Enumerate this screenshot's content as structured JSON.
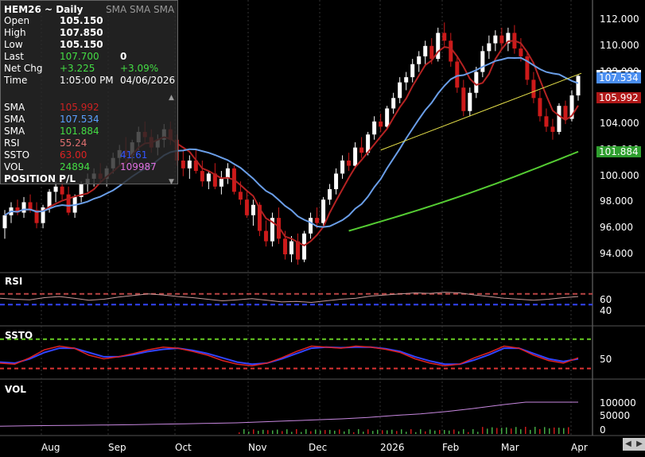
{
  "symbol_title": "HEM26 ~ Daily",
  "sma_header": "SMA SMA SMA",
  "info_rows": [
    {
      "label": "Open",
      "value": "105.150",
      "value2": ""
    },
    {
      "label": "High",
      "value": "107.850",
      "value2": ""
    },
    {
      "label": "Low",
      "value": "105.150",
      "value2": ""
    },
    {
      "label": "Last",
      "value": "107.700",
      "value2": "0"
    },
    {
      "label": "Net Chg",
      "value": "+3.225",
      "value2": "+3.09%"
    },
    {
      "label": "Time",
      "value": "1:05:00 PM",
      "value2": "04/06/2026"
    }
  ],
  "indicator_rows": [
    {
      "label": "SMA",
      "value": "105.992",
      "value2": "",
      "color": "#cc2222"
    },
    {
      "label": "SMA",
      "value": "107.534",
      "value2": "",
      "color": "#5aa0ff"
    },
    {
      "label": "SMA",
      "value": "101.884",
      "value2": "",
      "color": "#44dd44"
    },
    {
      "label": "RSI",
      "value": "55.24",
      "value2": "",
      "color": "#e07070"
    },
    {
      "label": "SSTO",
      "value": "63.00",
      "value2": "41.61",
      "color": "#dd2222",
      "color2": "#3355ff"
    },
    {
      "label": "VOL",
      "value": "24894",
      "value2": "109987",
      "color": "#44dd44",
      "color2": "#e070e0"
    }
  ],
  "position_pl": "POSITION P/L",
  "price_axis": [
    "112.000",
    "110.000",
    "108.000",
    "106.000",
    "104.000",
    "102.000",
    "100.000",
    "98.000",
    "96.000",
    "94.000"
  ],
  "price_tags": [
    {
      "text": "107.700",
      "bg": "#ffffff",
      "fg": "#000000"
    },
    {
      "text": "107.534",
      "bg": "#4a8ef0",
      "fg": "#ffffff"
    },
    {
      "text": "105.992",
      "bg": "#b01818",
      "fg": "#ffffff"
    },
    {
      "text": "101.884",
      "bg": "#2e9e2e",
      "fg": "#ffffff"
    }
  ],
  "panels": {
    "rsi": {
      "label": "RSI",
      "axis": [
        "60",
        "40"
      ]
    },
    "ssto": {
      "label": "SSTO",
      "axis": [
        "50"
      ]
    },
    "vol": {
      "label": "VOL",
      "axis": [
        "100000",
        "50000",
        "0"
      ]
    }
  },
  "months": [
    "Aug",
    "Sep",
    "Oct",
    "Nov",
    "Dec",
    "2026",
    "Feb",
    "Mar",
    "Apr"
  ],
  "colors": {
    "up": "#ffffff",
    "down": "#cc1a1a",
    "sma_short": "#b52222",
    "sma_mid": "#6a9ee8",
    "sma_long": "#55cc33",
    "trendline": "#e8e24a",
    "rsi_line": "#c79a9a",
    "rsi_hi": "#b84444",
    "rsi_lo": "#3344ff",
    "ssto_k": "#dd2222",
    "ssto_d": "#3344ff",
    "ssto_hi": "#66cc22",
    "ssto_lo": "#dd3333",
    "vol_line": "#c888e0",
    "vol_bar": "#44aa44"
  },
  "chart_data": {
    "type": "candlestick",
    "symbol": "HEM26",
    "period": "Daily",
    "ylim": [
      93,
      113
    ],
    "indicators": [
      {
        "name": "SMA",
        "last": 105.992
      },
      {
        "name": "SMA",
        "last": 107.534
      },
      {
        "name": "SMA",
        "last": 101.884
      },
      {
        "name": "RSI",
        "last": 55.24
      },
      {
        "name": "SSTO",
        "last": [
          63.0,
          41.61
        ]
      },
      {
        "name": "VOL",
        "last": [
          24894,
          109987
        ]
      }
    ],
    "candles": [
      [
        96.0,
        97.4,
        95.2,
        97.0
      ],
      [
        97.0,
        98.0,
        96.4,
        97.6
      ],
      [
        97.6,
        98.2,
        97.0,
        97.2
      ],
      [
        97.2,
        98.4,
        96.8,
        98.0
      ],
      [
        98.0,
        98.6,
        97.2,
        97.4
      ],
      [
        97.4,
        98.0,
        96.0,
        96.4
      ],
      [
        96.4,
        97.8,
        96.0,
        97.6
      ],
      [
        97.6,
        99.0,
        97.2,
        98.8
      ],
      [
        98.8,
        99.6,
        98.0,
        99.2
      ],
      [
        99.2,
        99.8,
        98.2,
        98.6
      ],
      [
        98.6,
        99.2,
        97.0,
        97.2
      ],
      [
        97.2,
        98.6,
        96.8,
        98.4
      ],
      [
        98.4,
        99.6,
        98.0,
        99.4
      ],
      [
        99.4,
        100.2,
        98.8,
        99.8
      ],
      [
        99.8,
        100.6,
        99.2,
        100.2
      ],
      [
        100.2,
        101.0,
        99.4,
        99.8
      ],
      [
        99.8,
        100.8,
        99.2,
        100.6
      ],
      [
        100.6,
        101.8,
        100.2,
        101.4
      ],
      [
        101.4,
        102.4,
        100.8,
        102.0
      ],
      [
        102.0,
        103.0,
        101.2,
        101.6
      ],
      [
        101.6,
        102.8,
        101.0,
        102.6
      ],
      [
        102.6,
        103.8,
        102.0,
        103.4
      ],
      [
        103.4,
        104.2,
        102.6,
        103.0
      ],
      [
        103.0,
        103.6,
        101.8,
        102.2
      ],
      [
        102.2,
        103.2,
        101.6,
        102.8
      ],
      [
        102.8,
        104.0,
        102.2,
        103.6
      ],
      [
        103.6,
        104.2,
        102.4,
        102.8
      ],
      [
        102.8,
        103.2,
        100.8,
        101.2
      ],
      [
        101.2,
        102.0,
        100.0,
        100.6
      ],
      [
        100.6,
        101.6,
        99.8,
        101.2
      ],
      [
        101.2,
        102.0,
        100.2,
        100.4
      ],
      [
        100.4,
        101.2,
        99.2,
        99.6
      ],
      [
        99.6,
        100.4,
        99.0,
        100.2
      ],
      [
        100.2,
        101.0,
        99.0,
        99.2
      ],
      [
        99.2,
        100.4,
        98.6,
        99.8
      ],
      [
        99.8,
        101.0,
        99.4,
        100.6
      ],
      [
        100.6,
        100.8,
        98.6,
        98.8
      ],
      [
        98.8,
        99.6,
        97.8,
        98.2
      ],
      [
        98.2,
        98.8,
        96.8,
        97.0
      ],
      [
        97.0,
        98.2,
        96.2,
        97.8
      ],
      [
        97.8,
        98.0,
        95.4,
        95.8
      ],
      [
        95.8,
        96.6,
        94.6,
        95.0
      ],
      [
        95.0,
        97.2,
        94.6,
        96.8
      ],
      [
        96.8,
        97.6,
        94.8,
        95.2
      ],
      [
        95.2,
        95.8,
        93.6,
        94.0
      ],
      [
        94.0,
        95.4,
        93.4,
        95.0
      ],
      [
        95.0,
        95.6,
        93.2,
        93.6
      ],
      [
        93.6,
        95.8,
        93.4,
        95.6
      ],
      [
        95.6,
        97.2,
        95.2,
        96.8
      ],
      [
        96.8,
        97.6,
        96.0,
        96.4
      ],
      [
        96.4,
        98.4,
        96.2,
        98.2
      ],
      [
        98.2,
        99.4,
        97.8,
        99.0
      ],
      [
        99.0,
        100.6,
        98.6,
        100.2
      ],
      [
        100.2,
        101.6,
        99.8,
        101.2
      ],
      [
        101.2,
        101.8,
        100.4,
        100.8
      ],
      [
        100.8,
        102.6,
        100.6,
        102.2
      ],
      [
        102.2,
        103.0,
        101.4,
        101.8
      ],
      [
        101.8,
        103.4,
        101.6,
        103.2
      ],
      [
        103.2,
        104.6,
        102.8,
        104.2
      ],
      [
        104.2,
        104.8,
        103.4,
        103.8
      ],
      [
        103.8,
        105.4,
        103.6,
        105.2
      ],
      [
        105.2,
        106.4,
        104.8,
        106.0
      ],
      [
        106.0,
        107.6,
        105.6,
        107.2
      ],
      [
        107.2,
        108.0,
        106.6,
        107.6
      ],
      [
        107.6,
        109.0,
        107.2,
        108.6
      ],
      [
        108.6,
        109.6,
        108.0,
        109.2
      ],
      [
        109.2,
        110.4,
        108.6,
        110.0
      ],
      [
        110.0,
        110.6,
        108.6,
        109.0
      ],
      [
        109.0,
        111.4,
        108.8,
        111.0
      ],
      [
        111.0,
        111.8,
        110.0,
        110.4
      ],
      [
        110.4,
        111.0,
        108.4,
        108.8
      ],
      [
        108.8,
        109.2,
        106.4,
        106.8
      ],
      [
        106.8,
        107.4,
        104.6,
        105.0
      ],
      [
        105.0,
        106.8,
        104.6,
        106.4
      ],
      [
        106.4,
        108.4,
        106.0,
        108.0
      ],
      [
        108.0,
        110.0,
        107.6,
        109.6
      ],
      [
        109.6,
        110.8,
        109.0,
        110.2
      ],
      [
        110.2,
        111.2,
        109.6,
        110.8
      ],
      [
        110.8,
        111.4,
        109.8,
        110.2
      ],
      [
        110.2,
        111.4,
        109.6,
        111.0
      ],
      [
        111.0,
        111.6,
        109.4,
        109.8
      ],
      [
        109.8,
        110.6,
        108.8,
        109.2
      ],
      [
        109.2,
        109.6,
        107.0,
        107.4
      ],
      [
        107.4,
        108.0,
        105.6,
        106.0
      ],
      [
        106.0,
        106.6,
        104.2,
        104.6
      ],
      [
        104.6,
        105.2,
        103.4,
        103.8
      ],
      [
        103.8,
        104.4,
        102.8,
        103.4
      ],
      [
        103.4,
        105.6,
        103.2,
        105.4
      ],
      [
        105.4,
        105.8,
        104.0,
        104.4
      ],
      [
        104.4,
        106.6,
        104.2,
        106.2
      ],
      [
        106.2,
        107.8,
        105.8,
        107.7
      ]
    ],
    "rsi": [
      52,
      50,
      49,
      53,
      55,
      52,
      48,
      50,
      54,
      57,
      60,
      58,
      55,
      53,
      50,
      47,
      49,
      51,
      48,
      45,
      46,
      44,
      47,
      50,
      52,
      56,
      58,
      60,
      62,
      61,
      63,
      62,
      58,
      55,
      52,
      50,
      48,
      50,
      53,
      55
    ],
    "ssto_k": [
      30,
      28,
      40,
      55,
      62,
      58,
      45,
      38,
      42,
      48,
      55,
      60,
      58,
      52,
      45,
      35,
      28,
      25,
      30,
      40,
      52,
      62,
      60,
      58,
      62,
      60,
      56,
      50,
      38,
      30,
      25,
      28,
      40,
      50,
      62,
      58,
      45,
      35,
      30,
      40
    ],
    "ssto_d": [
      32,
      30,
      38,
      50,
      58,
      58,
      50,
      42,
      42,
      46,
      52,
      56,
      58,
      54,
      48,
      40,
      32,
      28,
      30,
      38,
      48,
      58,
      60,
      59,
      60,
      60,
      57,
      52,
      42,
      34,
      28,
      28,
      36,
      46,
      58,
      58,
      48,
      38,
      33,
      38
    ],
    "volume": [
      12000,
      14000,
      15000,
      16000,
      17000,
      18000,
      20000,
      22000,
      24000,
      26000,
      30000,
      34000,
      38000,
      42000,
      48000,
      56000,
      62000,
      72000,
      84000,
      98000,
      110000,
      109987,
      109987
    ]
  }
}
